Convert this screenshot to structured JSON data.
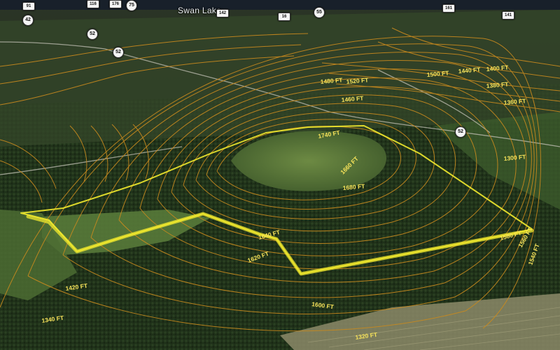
{
  "map": {
    "place_label": "Swan Lake",
    "route_shields": [
      "91",
      "116",
      "176",
      "75",
      "142",
      "55",
      "42",
      "52",
      "52",
      "52",
      "16",
      "141",
      "161"
    ],
    "contour_labels": [
      "1740 FT",
      "1680 FT",
      "1660 FT",
      "1640 FT",
      "1620 FT",
      "1600 FT",
      "1580 FT",
      "1560 FT",
      "1540 FT",
      "1520 FT",
      "1500 FT",
      "1480 FT",
      "1460 FT",
      "1440 FT",
      "1420 FT",
      "1400 FT",
      "1380 FT",
      "1360 FT",
      "1340 FT",
      "1320 FT",
      "1300 FT"
    ],
    "colors": {
      "boundary": "#f2ea2e",
      "contour": "#c98a1e",
      "contour_label": "#f7e35a",
      "forest": "#23361c",
      "field": "#4d6b32"
    }
  }
}
